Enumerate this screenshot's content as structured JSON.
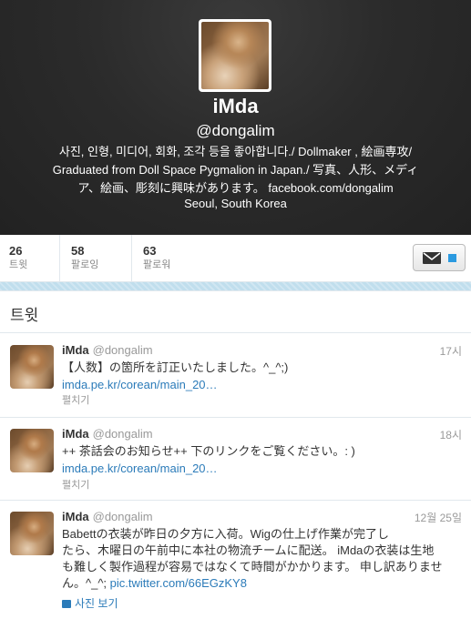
{
  "profile": {
    "display_name": "iMda",
    "screen_name": "@dongalim",
    "bio_line1": "사진, 인형, 미디어, 회화, 조각 등을 좋아합니다./ Dollmaker , 絵画専攻/",
    "bio_line2": "Graduated from Doll Space Pygmalion in Japan./ 写真、人形、メディ",
    "bio_line3": "ア、絵画、彫刻に興味があります。 facebook.com/dongalim",
    "location": "Seoul, South Korea"
  },
  "stats": [
    {
      "count": "26",
      "label": "트윗"
    },
    {
      "count": "58",
      "label": "팔로잉"
    },
    {
      "count": "63",
      "label": "팔로워"
    }
  ],
  "tweets_heading": "트윗",
  "tweets": [
    {
      "name": "iMda",
      "handle": "@dongalim",
      "time": "17시",
      "text": "【人数】の箇所を訂正いたしました。^_^;)",
      "link": "imda.pe.kr/corean/main_20…",
      "expand": "펼치기"
    },
    {
      "name": "iMda",
      "handle": "@dongalim",
      "time": "18시",
      "text": "++ 茶話会のお知らせ++ 下のリンクをご覧ください。: )",
      "link": "imda.pe.kr/corean/main_20…",
      "expand": "펼치기"
    },
    {
      "name": "iMda",
      "handle": "@dongalim",
      "time": "12월 25일",
      "text_line1": "Babettの衣装が昨日の夕方に入荷。Wigの仕上げ作業が完了し",
      "text_line2": "たら、木曜日の午前中に本社の物流チームに配送。 iMdaの衣装は生地",
      "text_line3": "も難しく製作過程が容易ではなくて時間がかかります。 申し訳ありませ",
      "text_line4_prefix": "ん。^_^;",
      "link": "pic.twitter.com/66EGzKY8",
      "media_label": "사진 보기"
    }
  ],
  "icons": {
    "message": "envelope-icon",
    "media": "photo-icon"
  },
  "colors": {
    "header_bg": "#2b2b2b",
    "link": "#2b7bb9",
    "accent": "#2b9ae0",
    "strip": "#c0deed"
  }
}
